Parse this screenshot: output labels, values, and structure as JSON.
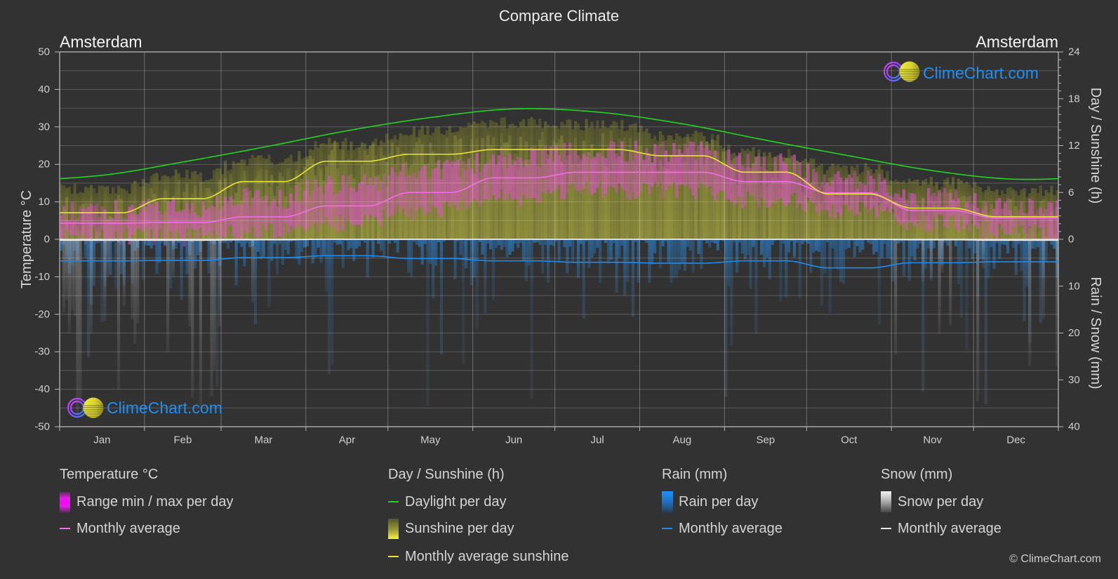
{
  "chart_data": {
    "type": "line",
    "title": "Compare Climate",
    "location_left": "Amsterdam",
    "location_right": "Amsterdam",
    "watermark": "ClimeChart.com",
    "categories": [
      "Jan",
      "Feb",
      "Mar",
      "Apr",
      "May",
      "Jun",
      "Jul",
      "Aug",
      "Sep",
      "Oct",
      "Nov",
      "Dec"
    ],
    "grid": true,
    "legend_position": "bottom",
    "axes": {
      "temperature": {
        "label": "Temperature °C",
        "side": "left",
        "min": -50,
        "max": 50,
        "ticks": [
          50,
          40,
          30,
          20,
          10,
          0,
          -10,
          -20,
          -30,
          -40,
          -50
        ]
      },
      "daylight_sunshine": {
        "label": "Day / Sunshine (h)",
        "side": "right-top",
        "min": 0,
        "max": 24,
        "ticks": [
          24,
          18,
          12,
          6,
          0
        ]
      },
      "rain_snow": {
        "label": "Rain / Snow (mm)",
        "side": "right-bottom",
        "min": 0,
        "max": 40,
        "inverted": true,
        "ticks": [
          0,
          10,
          20,
          30,
          40
        ]
      }
    },
    "series": [
      {
        "id": "temp_range",
        "name": "Range min / max per day",
        "type": "bar",
        "axis": "temperature",
        "color": "#e64fd2",
        "min": [
          0.8,
          0.6,
          2.2,
          4.3,
          7.8,
          10.9,
          12.9,
          12.8,
          10.6,
          7.7,
          4.2,
          1.9
        ],
        "max": [
          7.6,
          8.4,
          11.0,
          14.6,
          18.5,
          21.7,
          23.6,
          23.3,
          20.2,
          15.6,
          10.8,
          8.1
        ]
      },
      {
        "id": "temp_avg",
        "name": "Temperature monthly average",
        "type": "line",
        "axis": "temperature",
        "color": "#f26de6",
        "values": [
          4.3,
          4.5,
          6.0,
          8.9,
          12.5,
          16.4,
          17.9,
          17.9,
          15.4,
          12.4,
          7.7,
          5.7
        ]
      },
      {
        "id": "daylight",
        "name": "Daylight per day",
        "type": "line",
        "axis": "daylight_sunshine",
        "color": "#22d422",
        "values": [
          8.2,
          9.9,
          11.8,
          13.9,
          15.6,
          16.7,
          16.3,
          14.8,
          12.7,
          10.7,
          8.8,
          7.7
        ]
      },
      {
        "id": "sunshine_day",
        "name": "Sunshine per day",
        "type": "bar",
        "axis": "daylight_sunshine",
        "color": "#8c8c3a",
        "values": [
          6.4,
          8.2,
          10.1,
          12.2,
          13.9,
          15.0,
          14.7,
          13.2,
          11.1,
          9.1,
          7.2,
          6.1
        ]
      },
      {
        "id": "sunshine_avg",
        "name": "Monthly average sunshine",
        "type": "line",
        "axis": "daylight_sunshine",
        "color": "#e6e632",
        "values": [
          3.4,
          5.2,
          7.4,
          10.0,
          10.9,
          11.5,
          11.5,
          10.7,
          8.6,
          5.8,
          4.0,
          2.9
        ]
      },
      {
        "id": "rain_day",
        "name": "Rain per day",
        "type": "bar",
        "axis": "rain_snow",
        "color": "#2a7dc8",
        "values": [
          4.6,
          4.5,
          3.9,
          3.5,
          4.1,
          4.6,
          4.9,
          5.1,
          4.6,
          6.1,
          5.0,
          4.8
        ]
      },
      {
        "id": "rain_avg",
        "name": "Rain monthly average",
        "type": "line",
        "axis": "rain_snow",
        "color": "#1c8cf0",
        "values": [
          4.6,
          4.5,
          3.9,
          3.5,
          4.1,
          4.6,
          4.9,
          5.1,
          4.6,
          6.1,
          5.0,
          4.8
        ]
      },
      {
        "id": "snow_day",
        "name": "Snow per day",
        "type": "bar",
        "axis": "rain_snow",
        "color": "#bdbdbd",
        "values": [
          1.2,
          1.0,
          0.4,
          0.05,
          0,
          0,
          0,
          0,
          0,
          0,
          0.3,
          0.9
        ]
      },
      {
        "id": "snow_avg",
        "name": "Snow monthly average",
        "type": "line",
        "axis": "rain_snow",
        "color": "#ececec",
        "values": [
          0.2,
          0.2,
          0.1,
          0,
          0,
          0,
          0,
          0,
          0,
          0,
          0.1,
          0.2
        ]
      }
    ],
    "legend": [
      {
        "title": "Temperature °C",
        "items": [
          {
            "label": "Range min / max per day"
          },
          {
            "label": "Monthly average"
          }
        ]
      },
      {
        "title": "Day / Sunshine (h)",
        "items": [
          {
            "label": "Daylight per day"
          },
          {
            "label": "Sunshine per day"
          },
          {
            "label": "Monthly average sunshine"
          }
        ]
      },
      {
        "title": "Rain (mm)",
        "items": [
          {
            "label": "Rain per day"
          },
          {
            "label": "Monthly average"
          }
        ]
      },
      {
        "title": "Snow (mm)",
        "items": [
          {
            "label": "Snow per day"
          },
          {
            "label": "Monthly average"
          }
        ]
      }
    ]
  },
  "copyright": "© ClimeChart.com"
}
